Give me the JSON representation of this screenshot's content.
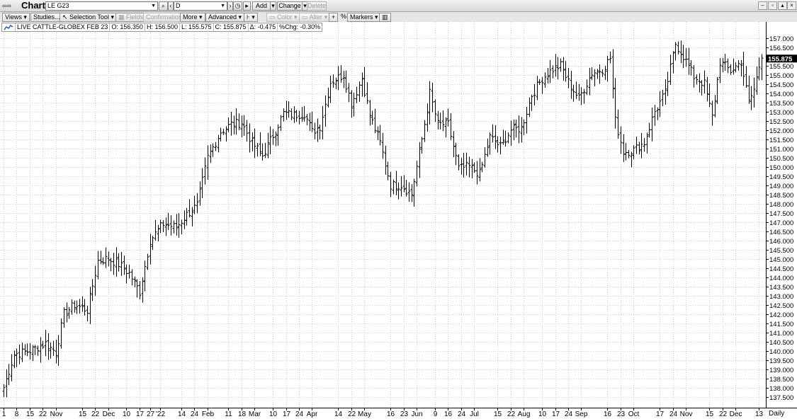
{
  "window": {
    "title": "Chart"
  },
  "header": {
    "symbol_value": "LE G23",
    "interval_value": "D",
    "add_label": "Add",
    "change_label": "Change",
    "delete_label": "Delete"
  },
  "toolbar": {
    "views_label": "Views",
    "studies_label": "Studies...",
    "selection_tool_label": "Selection Tool",
    "fields_label": "Fields...",
    "confirmation_label": "Confirmation",
    "more_label": "More",
    "advanced_label": "Advanced",
    "color_label": "Color",
    "alter_label": "Alter",
    "percent_label": "%",
    "markers_label": "Markers"
  },
  "legend": {
    "name": "LIVE CATTLE-GLOBEX FEB 23",
    "open": "O: 156.350",
    "high": "H: 156.500",
    "low": "L: 155.575",
    "close": "C: 155.875",
    "change": "Δ: -0.475",
    "pct_change": "%Chg: -0.30%"
  },
  "colors": {
    "bar": "#000000",
    "grid": "#d0d0d0",
    "last_price_bg": "#000000",
    "last_price_fg": "#ffffff"
  },
  "chart_data": {
    "type": "ohlc",
    "last_price": "155.875",
    "y_axis": {
      "ylim": [
        137.0,
        157.5
      ],
      "ticks": [
        137.5,
        138.0,
        138.5,
        139.0,
        139.5,
        140.0,
        140.5,
        141.0,
        141.5,
        142.0,
        142.5,
        143.0,
        143.5,
        144.0,
        144.5,
        145.0,
        145.5,
        146.0,
        146.5,
        147.0,
        147.5,
        148.0,
        148.5,
        149.0,
        149.5,
        150.0,
        150.5,
        151.0,
        151.5,
        152.0,
        152.5,
        153.0,
        153.5,
        154.0,
        154.5,
        155.0,
        155.5,
        156.0,
        156.5,
        157.0
      ],
      "tick_labels": [
        "137.500",
        "138.000",
        "138.500",
        "139.000",
        "139.500",
        "140.000",
        "140.500",
        "141.000",
        "141.500",
        "142.000",
        "142.500",
        "143.000",
        "143.500",
        "144.000",
        "144.500",
        "145.000",
        "145.500",
        "146.000",
        "146.500",
        "147.000",
        "147.500",
        "148.000",
        "148.500",
        "149.000",
        "149.500",
        "150.000",
        "150.500",
        "151.000",
        "151.500",
        "152.000",
        "152.500",
        "153.000",
        "153.500",
        "154.000",
        "154.500",
        "155.000",
        "155.500",
        "156.000",
        "156.500",
        "157.000"
      ]
    },
    "x_axis": {
      "interval_label": "Daily",
      "labels": [
        {
          "label": "1",
          "bar": 0
        },
        {
          "label": "8",
          "bar": 5
        },
        {
          "label": "15",
          "bar": 10
        },
        {
          "label": "22",
          "bar": 15
        },
        {
          "label": "Nov",
          "bar": 20
        },
        {
          "label": "15",
          "bar": 30
        },
        {
          "label": "22",
          "bar": 35
        },
        {
          "label": "Dec",
          "bar": 40
        },
        {
          "label": "10",
          "bar": 47
        },
        {
          "label": "17",
          "bar": 52
        },
        {
          "label": "27",
          "bar": 56
        },
        {
          "label": "'22",
          "bar": 60
        },
        {
          "label": "14",
          "bar": 68
        },
        {
          "label": "24",
          "bar": 73
        },
        {
          "label": "Feb",
          "bar": 78
        },
        {
          "label": "11",
          "bar": 86
        },
        {
          "label": "18",
          "bar": 91
        },
        {
          "label": "Mar",
          "bar": 96
        },
        {
          "label": "10",
          "bar": 103
        },
        {
          "label": "17",
          "bar": 108
        },
        {
          "label": "24",
          "bar": 113
        },
        {
          "label": "Apr",
          "bar": 118
        },
        {
          "label": "14",
          "bar": 128
        },
        {
          "label": "22",
          "bar": 133
        },
        {
          "label": "May",
          "bar": 138
        },
        {
          "label": "16",
          "bar": 148
        },
        {
          "label": "23",
          "bar": 153
        },
        {
          "label": "Jun",
          "bar": 158
        },
        {
          "label": "9",
          "bar": 165
        },
        {
          "label": "16",
          "bar": 170
        },
        {
          "label": "24",
          "bar": 175
        },
        {
          "label": "Jul",
          "bar": 180
        },
        {
          "label": "15",
          "bar": 189
        },
        {
          "label": "22",
          "bar": 194
        },
        {
          "label": "Aug",
          "bar": 199
        },
        {
          "label": "10",
          "bar": 206
        },
        {
          "label": "17",
          "bar": 211
        },
        {
          "label": "24",
          "bar": 216
        },
        {
          "label": "Sep",
          "bar": 221
        },
        {
          "label": "16",
          "bar": 231
        },
        {
          "label": "23",
          "bar": 236
        },
        {
          "label": "Oct",
          "bar": 241
        },
        {
          "label": "17",
          "bar": 251
        },
        {
          "label": "24",
          "bar": 256
        },
        {
          "label": "Nov",
          "bar": 261
        },
        {
          "label": "15",
          "bar": 270
        },
        {
          "label": "22",
          "bar": 275
        },
        {
          "label": "Dec",
          "bar": 280
        },
        {
          "label": "13",
          "bar": 289
        }
      ]
    },
    "series_anchors": [
      [
        0,
        138.0
      ],
      [
        4,
        139.8
      ],
      [
        10,
        140.0
      ],
      [
        16,
        140.4
      ],
      [
        20,
        139.9
      ],
      [
        23,
        142.0
      ],
      [
        27,
        142.5
      ],
      [
        32,
        142.2
      ],
      [
        36,
        144.9
      ],
      [
        40,
        145.0
      ],
      [
        44,
        144.7
      ],
      [
        48,
        144.2
      ],
      [
        52,
        143.2
      ],
      [
        56,
        146.0
      ],
      [
        61,
        146.9
      ],
      [
        66,
        146.7
      ],
      [
        70,
        147.4
      ],
      [
        74,
        147.9
      ],
      [
        78,
        150.5
      ],
      [
        83,
        151.9
      ],
      [
        87,
        152.3
      ],
      [
        91,
        152.4
      ],
      [
        95,
        151.3
      ],
      [
        99,
        150.6
      ],
      [
        103,
        151.7
      ],
      [
        107,
        152.9
      ],
      [
        111,
        152.8
      ],
      [
        115,
        152.9
      ],
      [
        118,
        151.9
      ],
      [
        121,
        152.2
      ],
      [
        125,
        154.6
      ],
      [
        130,
        155.0
      ],
      [
        133,
        153.4
      ],
      [
        137,
        154.8
      ],
      [
        140,
        152.8
      ],
      [
        144,
        151.3
      ],
      [
        148,
        149.0
      ],
      [
        152,
        149.0
      ],
      [
        156,
        148.5
      ],
      [
        160,
        151.5
      ],
      [
        163,
        154.0
      ],
      [
        166,
        152.3
      ],
      [
        170,
        152.3
      ],
      [
        174,
        149.9
      ],
      [
        178,
        150.0
      ],
      [
        182,
        149.6
      ],
      [
        186,
        151.6
      ],
      [
        190,
        151.1
      ],
      [
        194,
        152.0
      ],
      [
        198,
        152.1
      ],
      [
        202,
        153.9
      ],
      [
        206,
        154.8
      ],
      [
        210,
        155.3
      ],
      [
        213,
        155.5
      ],
      [
        216,
        154.6
      ],
      [
        220,
        153.7
      ],
      [
        225,
        155.1
      ],
      [
        229,
        155.3
      ],
      [
        232,
        155.9
      ],
      [
        234,
        152.5
      ],
      [
        237,
        150.8
      ],
      [
        241,
        150.9
      ],
      [
        245,
        151.3
      ],
      [
        249,
        153.0
      ],
      [
        253,
        154.0
      ],
      [
        257,
        156.7
      ],
      [
        260,
        156.0
      ],
      [
        264,
        154.9
      ],
      [
        268,
        154.5
      ],
      [
        271,
        152.7
      ],
      [
        274,
        155.7
      ],
      [
        278,
        155.2
      ],
      [
        282,
        155.7
      ],
      [
        285,
        153.5
      ],
      [
        287,
        154.2
      ],
      [
        290,
        156.1
      ]
    ]
  }
}
